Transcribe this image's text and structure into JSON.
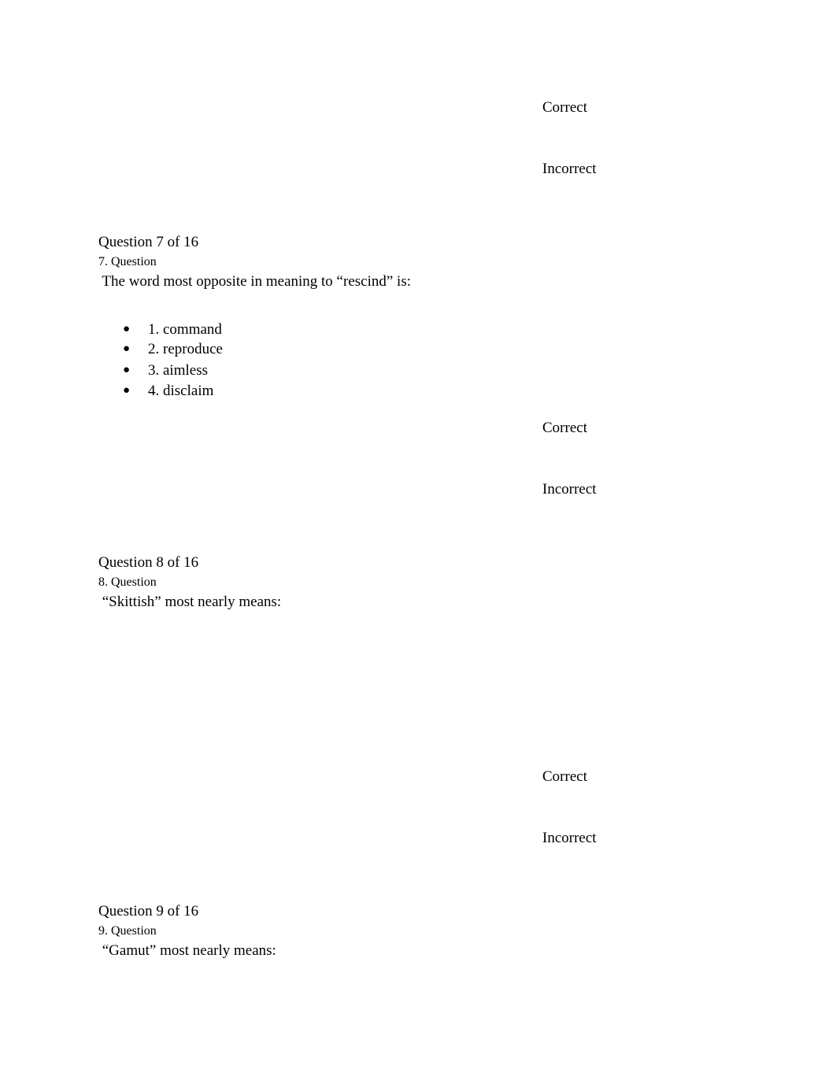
{
  "feedback": {
    "correct_label": "Correct",
    "incorrect_label": "Incorrect"
  },
  "questions": [
    {
      "counter": "Question 7 of 16",
      "label": "7. Question",
      "prompt": " The word most opposite in meaning to “rescind” is:",
      "options": [
        "1. command",
        "2. reproduce",
        "3. aimless",
        "4. disclaim"
      ]
    },
    {
      "counter": "Question 8 of 16",
      "label": "8. Question",
      "prompt": " “Skittish” most nearly means:"
    },
    {
      "counter": "Question 9 of 16",
      "label": "9. Question",
      "prompt": " “Gamut” most nearly means:"
    }
  ],
  "bullet_glyph": "●"
}
